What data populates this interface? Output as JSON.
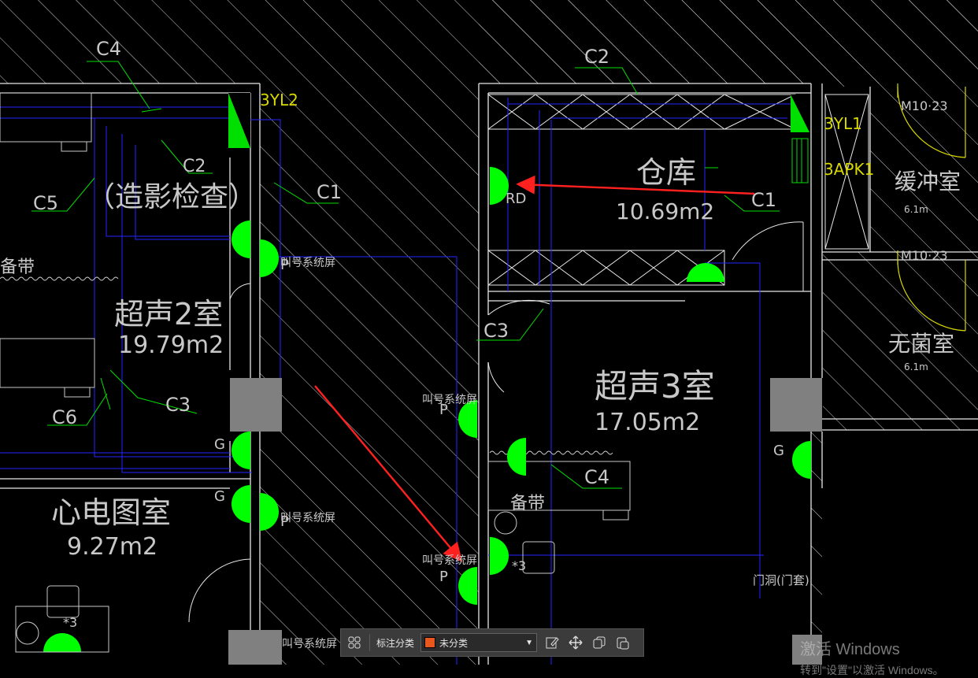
{
  "rooms": {
    "ultrasound2": {
      "name": "超声2室",
      "area": "19.79m2"
    },
    "angiography": {
      "name": "（造影检查）"
    },
    "ecg": {
      "name": "心电图室",
      "area": "9.27m2"
    },
    "warehouse": {
      "name": "仓库",
      "area": "10.69m2"
    },
    "ultrasound3": {
      "name": "超声3室",
      "area": "17.05m2"
    },
    "buffer": {
      "name": "缓冲室",
      "area": "6.1m"
    },
    "sterile": {
      "name": "无菌室",
      "area": "6.1m"
    }
  },
  "labels": {
    "c1a": "C1",
    "c1b": "C1",
    "c2a": "C2",
    "c2b": "C2",
    "c3a": "C3",
    "c3b": "C3",
    "c4a": "C4",
    "c4b": "C4",
    "c5": "C5",
    "c6": "C6",
    "byl2": "3YL2",
    "byl1": "3YL1",
    "bapk1": "3APK1",
    "rd": "RD",
    "p1": "P",
    "p2": "P",
    "p3": "P",
    "p4": "P",
    "g1": "G",
    "g2": "G",
    "g3": "G",
    "x3a": "*3",
    "x3b": "*3",
    "queue1": "叫号系统屏",
    "queue2": "叫号系统屏",
    "queue3": "叫号系统屏",
    "queue4": "叫号系统屏",
    "queue5": "叫号系统屏",
    "spare_a": "备带",
    "spare_b": "备带",
    "door_hole": "门洞(门套)",
    "m10a": "M10·23",
    "m10b": "M10·23"
  },
  "toolbar": {
    "category_label": "标注分类",
    "selected_category": "未分类",
    "swatch_color": "#e8581c"
  },
  "watermark": {
    "title": "激活 Windows",
    "subtitle": "转到\"设置\"以激活 Windows。"
  },
  "colors": {
    "background": "#000000",
    "wall": "#e8e8e8",
    "wire": "#2424ff",
    "leader": "#00e000",
    "fixture": "#00ff00",
    "tag": "#d8d800",
    "arrow": "#ff2020",
    "column": "#808080",
    "text": "#c8c8c8"
  }
}
